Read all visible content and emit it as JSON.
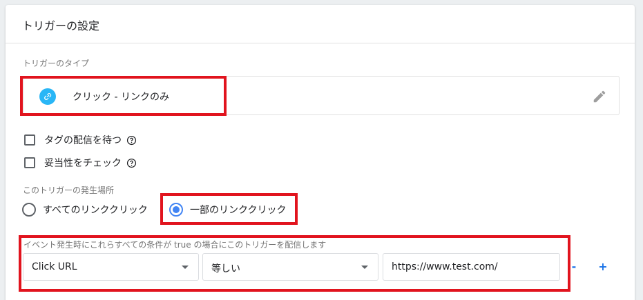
{
  "card": {
    "title": "トリガーの設定"
  },
  "trigger_type": {
    "section_label": "トリガーのタイプ",
    "label": "クリック - リンクのみ",
    "icon": "link-icon",
    "edit_icon": "pencil-icon",
    "icon_color": "#29b6f6"
  },
  "options": [
    {
      "label": "タグの配信を待つ",
      "checked": false
    },
    {
      "label": "妥当性をチェック",
      "checked": false
    }
  ],
  "fire_on": {
    "section_label": "このトリガーの発生場所",
    "choices": [
      {
        "label": "すべてのリンククリック",
        "selected": false
      },
      {
        "label": "一部のリンククリック",
        "selected": true
      }
    ]
  },
  "condition": {
    "label": "イベント発生時にこれらすべての条件が true の場合にこのトリガーを配信します",
    "variable": "Click URL",
    "operator": "等しい",
    "value": "https://www.test.com/",
    "remove_label": "-",
    "add_label": "+"
  },
  "colors": {
    "accent": "#4285f4",
    "link_blue": "#1a73e8",
    "highlight_red": "#e1141e"
  }
}
